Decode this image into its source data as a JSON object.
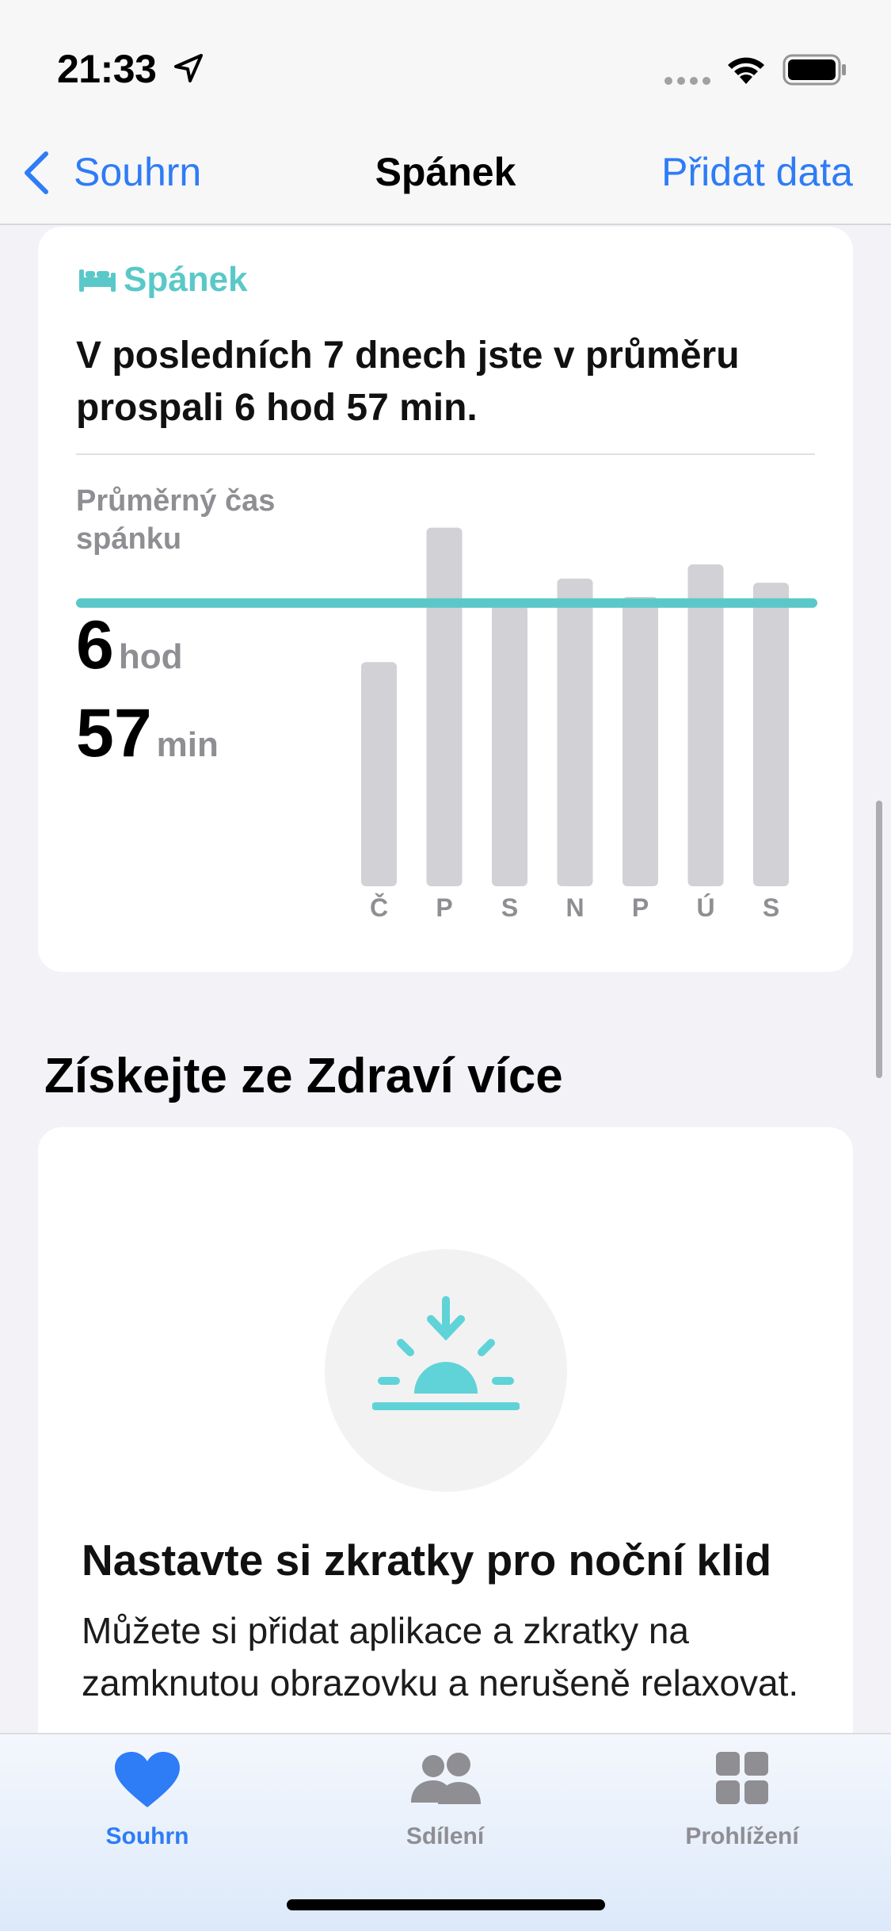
{
  "status_bar": {
    "time": "21:33"
  },
  "nav": {
    "back_label": "Souhrn",
    "title": "Spánek",
    "action_label": "Přidat data"
  },
  "sleep_card": {
    "category": "Spánek",
    "headline": "V posledních 7 dnech jste v průměru prospali 6 hod 57 min.",
    "avg_label": "Průměrný čas spánku",
    "avg_hours": "6",
    "avg_hours_unit": "hod",
    "avg_minutes": "57",
    "avg_minutes_unit": "min",
    "accent_color": "#5ac8c8"
  },
  "chart_data": {
    "type": "bar",
    "categories": [
      "Č",
      "P",
      "S",
      "N",
      "P",
      "Ú",
      "S"
    ],
    "values": [
      5.5,
      8.8,
      6.9,
      7.55,
      7.1,
      7.9,
      7.45
    ],
    "average": 6.95,
    "ylim": [
      0,
      10
    ],
    "bar_color": "#d1d1d6",
    "average_color": "#5ac8c8"
  },
  "section": {
    "heading": "Získejte ze Zdraví více"
  },
  "promo": {
    "title": "Nastavte si zkratky pro noční klid",
    "body": "Můžete si přidat aplikace a zkratky na zamknutou obrazovku a nerušeně relaxovat.",
    "icon": "sunrise-icon"
  },
  "tab_bar": {
    "tabs": [
      {
        "label": "Souhrn",
        "icon": "heart-icon",
        "active": true
      },
      {
        "label": "Sdílení",
        "icon": "people-icon",
        "active": false
      },
      {
        "label": "Prohlížení",
        "icon": "grid-icon",
        "active": false
      }
    ]
  }
}
